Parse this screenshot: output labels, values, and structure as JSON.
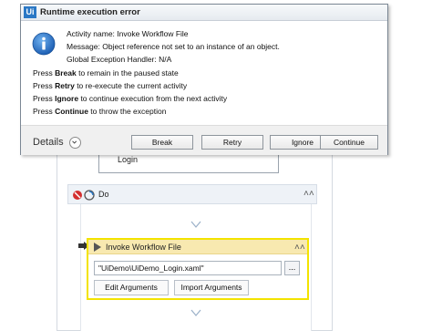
{
  "dialog": {
    "title": "Runtime execution error",
    "logo_text": "Ui",
    "info_icon": "info-icon",
    "message": {
      "activity": "Activity name: Invoke Workflow File",
      "message": "Message: Object reference not set to an instance of an object.",
      "handler": "Global Exception Handler: N/A"
    },
    "instructions": [
      {
        "prefix": "Press ",
        "key": "Break",
        "suffix": " to remain in the paused state"
      },
      {
        "prefix": "Press ",
        "key": "Retry",
        "suffix": " to re-execute the current activity"
      },
      {
        "prefix": "Press ",
        "key": "Ignore",
        "suffix": " to continue execution from the next activity"
      },
      {
        "prefix": "Press ",
        "key": "Continue",
        "suffix": " to throw the exception"
      }
    ],
    "details_label": "Details",
    "buttons": {
      "break": "Break",
      "retry": "Retry",
      "ignore": "Ignore",
      "continue": "Continue"
    }
  },
  "designer": {
    "login_label": "Login",
    "do_label": "Do",
    "workflow_title": "Invoke Workflow File",
    "workflow_path": "\"UiDemo\\UiDemo_Login.xaml\"",
    "ellipsis": "...",
    "edit_args": "Edit Arguments",
    "import_args": "Import Arguments",
    "highlight_color": "#f3e300"
  }
}
